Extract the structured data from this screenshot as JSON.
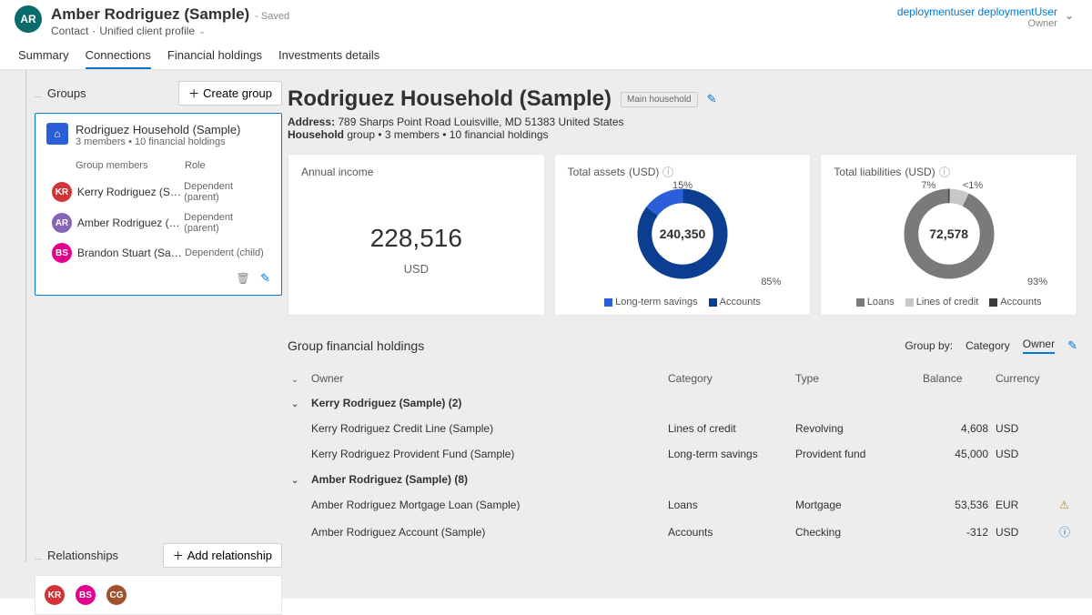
{
  "header": {
    "avatar_initials": "AR",
    "title": "Amber Rodriguez (Sample)",
    "saved": "- Saved",
    "entity": "Contact",
    "form": "Unified client profile",
    "user_name": "deploymentuser deploymentUser",
    "user_role": "Owner"
  },
  "tabs": [
    "Summary",
    "Connections",
    "Financial holdings",
    "Investments details"
  ],
  "left": {
    "groups_label": "Groups",
    "create_group": "Create group",
    "group_card": {
      "name": "Rodriguez Household (Sample)",
      "meta": "3 members • 10 financial holdings",
      "col1": "Group members",
      "col2": "Role",
      "members": [
        {
          "initials": "KR",
          "color": "c-red",
          "name": "Kerry Rodriguez (Sa...",
          "role": "Dependent (parent)"
        },
        {
          "initials": "AR",
          "color": "c-purple",
          "name": "Amber Rodriguez (S...",
          "role": "Dependent (parent)"
        },
        {
          "initials": "BS",
          "color": "c-pink",
          "name": "Brandon Stuart (Sam...",
          "role": "Dependent (child)"
        }
      ]
    },
    "relationships_label": "Relationships",
    "add_relationship": "Add relationship",
    "rel_avatars": [
      {
        "initials": "KR",
        "color": "c-red"
      },
      {
        "initials": "BS",
        "color": "c-pink"
      },
      {
        "initials": "CG",
        "color": "c-brown"
      }
    ]
  },
  "household": {
    "title": "Rodriguez Household (Sample)",
    "chip": "Main household",
    "address_label": "Address:",
    "address": "789 Sharps Point Road Louisville, MD 51383 United States",
    "household_label": "Household",
    "household_meta": "group • 3 members • 10 financial holdings"
  },
  "cards": {
    "income": {
      "title": "Annual income",
      "value": "228,516",
      "unit": "USD"
    },
    "assets": {
      "title": "Total assets",
      "unit": "(USD)",
      "center": "240,350",
      "pct_top": "15%",
      "pct_bottom": "85%",
      "legend": [
        {
          "label": "Long-term savings",
          "color": "#2b5fd9"
        },
        {
          "label": "Accounts",
          "color": "#0b3e91"
        }
      ]
    },
    "liab": {
      "title": "Total liabilities",
      "unit": "(USD)",
      "center": "72,578",
      "pct_top_l": "7%",
      "pct_top_r": "<1%",
      "pct_bottom": "93%",
      "legend": [
        {
          "label": "Loans",
          "color": "#7a7a7a"
        },
        {
          "label": "Lines of credit",
          "color": "#c8c8c8"
        },
        {
          "label": "Accounts",
          "color": "#3b3b3b"
        }
      ]
    }
  },
  "chart_data": [
    {
      "type": "pie",
      "title": "Total assets (USD)",
      "series": [
        {
          "name": "Long-term savings",
          "value": 15,
          "color": "#2b5fd9"
        },
        {
          "name": "Accounts",
          "value": 85,
          "color": "#0b3e91"
        }
      ],
      "center_label": "240,350"
    },
    {
      "type": "pie",
      "title": "Total liabilities (USD)",
      "series": [
        {
          "name": "Loans",
          "value": 93,
          "color": "#7a7a7a"
        },
        {
          "name": "Lines of credit",
          "value": 7,
          "color": "#c8c8c8"
        },
        {
          "name": "Accounts",
          "value": 0.5,
          "color": "#3b3b3b"
        }
      ],
      "center_label": "72,578"
    }
  ],
  "holdings": {
    "title": "Group financial holdings",
    "group_by_label": "Group by:",
    "group_by_options": [
      "Category",
      "Owner"
    ],
    "columns": [
      "Owner",
      "Category",
      "Type",
      "Balance",
      "Currency"
    ],
    "groups": [
      {
        "label": "Kerry Rodriguez (Sample) (2)",
        "rows": [
          {
            "owner": "Kerry Rodriguez Credit Line (Sample)",
            "category": "Lines of credit",
            "type": "Revolving",
            "balance": "4,608",
            "currency": "USD",
            "indicator": ""
          },
          {
            "owner": "Kerry Rodriguez Provident Fund (Sample)",
            "category": "Long-term savings",
            "type": "Provident fund",
            "balance": "45,000",
            "currency": "USD",
            "indicator": ""
          }
        ]
      },
      {
        "label": "Amber Rodriguez (Sample) (8)",
        "rows": [
          {
            "owner": "Amber Rodriguez Mortgage Loan (Sample)",
            "category": "Loans",
            "type": "Mortgage",
            "balance": "53,536",
            "currency": "EUR",
            "indicator": "warn"
          },
          {
            "owner": "Amber Rodriguez Account (Sample)",
            "category": "Accounts",
            "type": "Checking",
            "balance": "-312",
            "currency": "USD",
            "indicator": "info"
          }
        ]
      }
    ]
  }
}
